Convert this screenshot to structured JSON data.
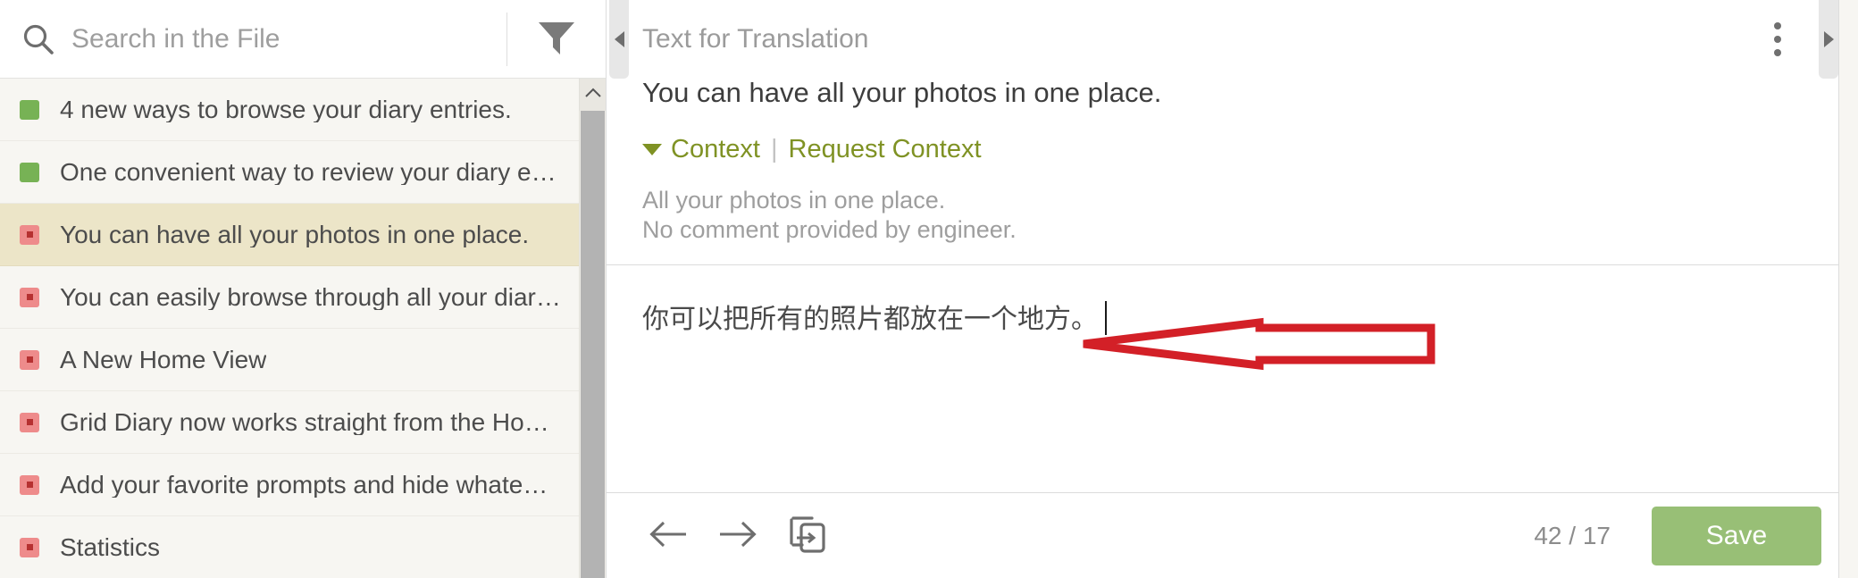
{
  "sidebar": {
    "search": {
      "placeholder": "Search in the File",
      "value": "",
      "icon": "search-icon"
    },
    "filter": {
      "icon": "filter-icon",
      "label": "Filter"
    },
    "scrollbar": {
      "up_icon": "chevron-up-icon"
    },
    "items": [
      {
        "label": "4 new ways to browse your diary entries.",
        "status": "green",
        "selected": false
      },
      {
        "label": "One convenient way to review your diary e…",
        "status": "green",
        "selected": false
      },
      {
        "label": "You can have all your photos in one place.",
        "status": "red",
        "selected": true
      },
      {
        "label": "You can easily browse through all your diar…",
        "status": "red",
        "selected": false
      },
      {
        "label": "A New Home View",
        "status": "red",
        "selected": false
      },
      {
        "label": "Grid Diary now works straight from the Ho…",
        "status": "red",
        "selected": false
      },
      {
        "label": "Add your favorite prompts and hide whate…",
        "status": "red",
        "selected": false
      },
      {
        "label": "Statistics",
        "status": "red",
        "selected": false
      }
    ]
  },
  "panel_handles": {
    "left": {
      "icon": "triangle-left-icon",
      "label": "Collapse left panel"
    },
    "right": {
      "icon": "triangle-right-icon",
      "label": "Expand right panel"
    }
  },
  "main": {
    "header": {
      "title": "Text for Translation",
      "menu_icon": "kebab-menu-icon"
    },
    "source_text": "You can have all your photos in one place.",
    "context": {
      "caret_icon": "triangle-down-icon",
      "toggle_label": "Context",
      "separator": "|",
      "request_label": "Request Context",
      "lines": [
        "All your photos in one place.",
        "No comment provided by engineer."
      ]
    },
    "target": {
      "value": "你可以把所有的照片都放在一个地方。",
      "has_caret": true
    },
    "toolbar": {
      "prev_icon": "arrow-left-icon",
      "next_icon": "arrow-right-icon",
      "copy_source_icon": "copy-source-to-target-icon",
      "counter": "42 / 17",
      "save_label": "Save"
    }
  },
  "annotation": {
    "type": "arrow",
    "direction": "left",
    "color": "#d32027"
  },
  "colors": {
    "accent_green": "#7f9224",
    "save_green": "#98bf76",
    "status_green": "#77b255",
    "status_red": "#ee8b8b",
    "selected_row": "#ece5c8",
    "annotation_red": "#d32027"
  }
}
